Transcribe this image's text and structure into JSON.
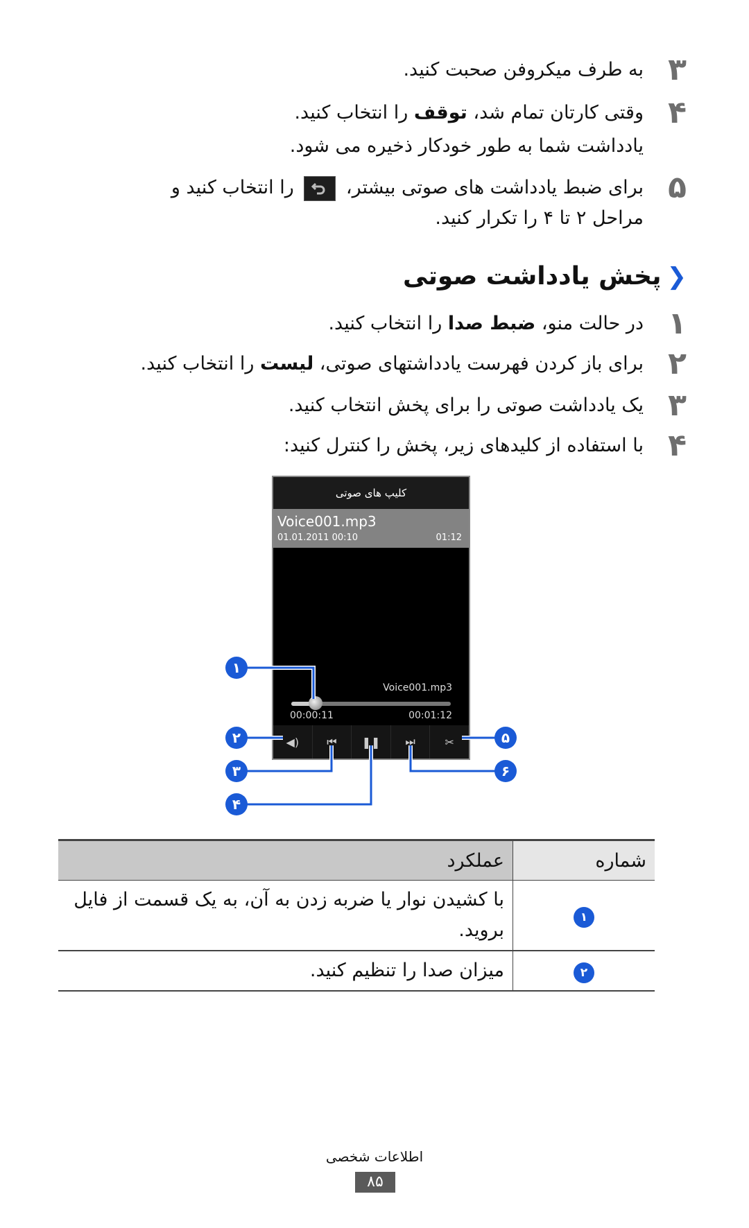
{
  "steps_top": [
    {
      "num": "۳",
      "text": "به طرف میکروفن صحبت کنید."
    },
    {
      "num": "۴",
      "text_before": "وقتی کارتان تمام شد، ",
      "bold": "توقف",
      "text_after": " را انتخاب کنید."
    },
    {
      "num": "",
      "text": "یادداشت شما به طور خودکار ذخیره می شود."
    },
    {
      "num": "۵",
      "text_before": "برای ضبط یادداشت های صوتی بیشتر، ",
      "icon": "back-icon",
      "text_after": " را انتخاب کنید و"
    },
    {
      "num": "",
      "text": "مراحل ۲ تا ۴ را تکرار کنید."
    }
  ],
  "section": {
    "chevron": "❮",
    "title": "پخش یادداشت صوتی"
  },
  "steps_section": [
    {
      "num": "۱",
      "text_before": "در حالت منو، ",
      "bold": "ضبط صدا",
      "text_after": " را انتخاب کنید."
    },
    {
      "num": "۲",
      "text_before": "برای باز کردن فهرست یادداشتهای صوتی، ",
      "bold": "لیست",
      "text_after": " را انتخاب کنید."
    },
    {
      "num": "۳",
      "text": "یک یادداشت صوتی را برای پخش انتخاب کنید."
    },
    {
      "num": "۴",
      "text": "با استفاده از کلیدهای زیر، پخش را کنترل کنید:"
    }
  ],
  "phone": {
    "header": "کلیپ های صوتی",
    "item": {
      "title": "Voice001.mp3",
      "date": "01.01.2011 00:10",
      "duration": "01:12"
    },
    "now_playing": "Voice001.mp3",
    "elapsed": "00:00:11",
    "total": "00:01:12",
    "progress_fraction": 0.15,
    "controls": [
      {
        "name": "volume-icon",
        "glyph": "◀)"
      },
      {
        "name": "rewind-icon",
        "glyph": "⏮"
      },
      {
        "name": "pause-icon",
        "glyph": "❚❚"
      },
      {
        "name": "fast-forward-icon",
        "glyph": "⏭"
      },
      {
        "name": "scissors-icon",
        "glyph": "✂"
      }
    ]
  },
  "callouts": [
    "۱",
    "۲",
    "۳",
    "۴",
    "۵",
    "۶"
  ],
  "table": {
    "headers": {
      "number": "شماره",
      "function": "عملکرد"
    },
    "rows": [
      {
        "badge": "۱",
        "text": "با کشیدن نوار یا ضربه زدن به آن، به یک قسمت از فایل بروید."
      },
      {
        "badge": "۲",
        "text": "میزان صدا را تنظیم کنید."
      }
    ]
  },
  "footer": {
    "label": "اطلاعات شخصی",
    "page": "۸۵"
  },
  "colors": {
    "accent": "#1a5ad6",
    "step_number": "#6e6e6e"
  }
}
